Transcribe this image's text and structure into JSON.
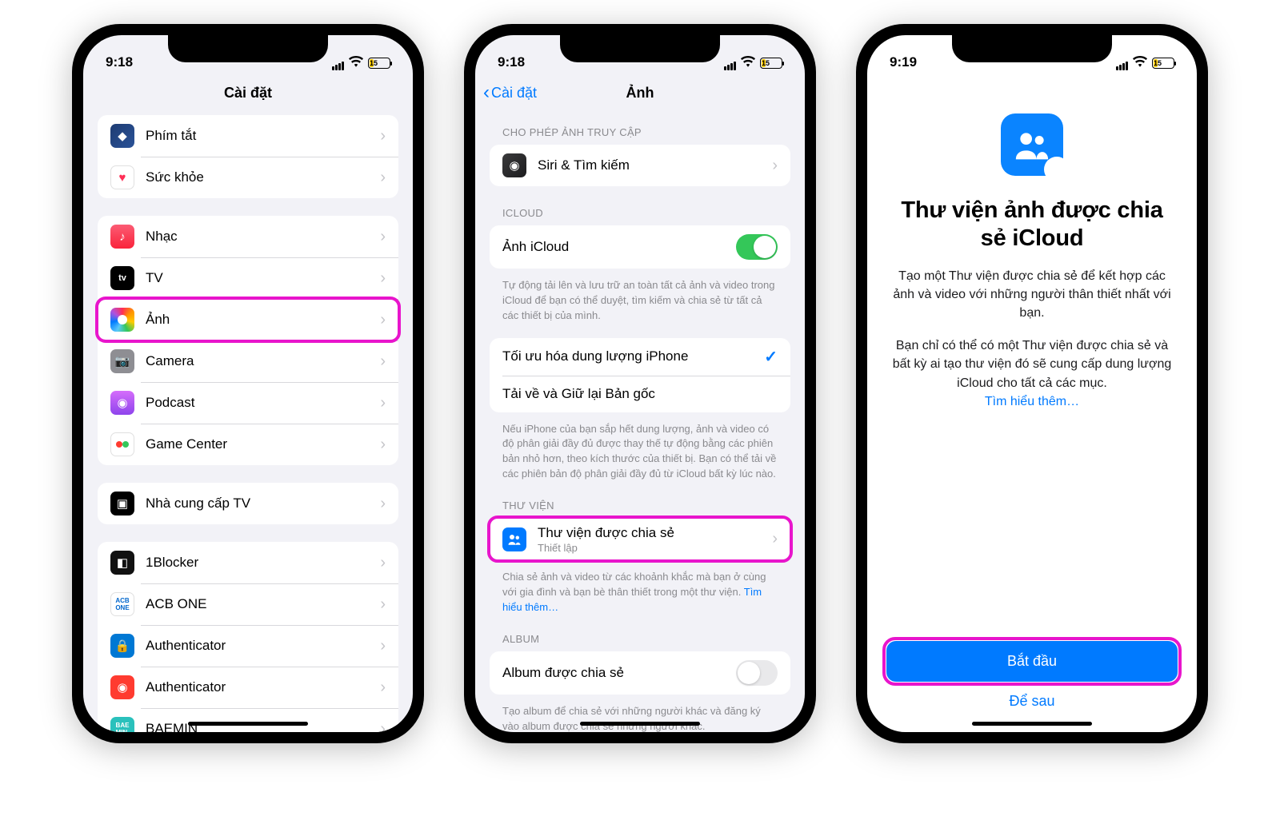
{
  "screen1": {
    "time": "9:18",
    "battery": "15",
    "title": "Cài đặt",
    "group1": [
      {
        "label": "Phím tắt"
      },
      {
        "label": "Sức khỏe"
      }
    ],
    "group2": [
      {
        "label": "Nhạc"
      },
      {
        "label": "TV"
      },
      {
        "label": "Ảnh",
        "hilite": true
      },
      {
        "label": "Camera"
      },
      {
        "label": "Podcast"
      },
      {
        "label": "Game Center"
      }
    ],
    "group3": [
      {
        "label": "Nhà cung cấp TV"
      }
    ],
    "group4": [
      {
        "label": "1Blocker"
      },
      {
        "label": "ACB ONE"
      },
      {
        "label": "Authenticator"
      },
      {
        "label": "Authenticator"
      },
      {
        "label": "BAEMIN"
      }
    ]
  },
  "screen2": {
    "time": "9:18",
    "battery": "15",
    "back_label": "Cài đặt",
    "title": "Ảnh",
    "sec_access": "CHO PHÉP ẢNH TRUY CẬP",
    "siri": "Siri & Tìm kiếm",
    "sec_icloud": "ICLOUD",
    "icloud_photos": "Ảnh iCloud",
    "icloud_desc": "Tự động tải lên và lưu trữ an toàn tất cả ảnh và video trong iCloud để bạn có thể duyệt, tìm kiếm và chia sẻ từ tất cả các thiết bị của mình.",
    "optimize": "Tối ưu hóa dung lượng iPhone",
    "download": "Tải về và Giữ lại Bản gốc",
    "optimize_desc": "Nếu iPhone của bạn sắp hết dung lượng, ảnh và video có độ phân giải đầy đủ được thay thế tự động bằng các phiên bản nhỏ hơn, theo kích thước của thiết bị. Bạn có thể tải về các phiên bản độ phân giải đầy đủ từ iCloud bất kỳ lúc nào.",
    "sec_library": "THƯ VIỆN",
    "shared_library": "Thư viện được chia sẻ",
    "shared_library_sub": "Thiết lập",
    "shared_desc": "Chia sẻ ảnh và video từ các khoảnh khắc mà bạn ở cùng với gia đình và bạn bè thân thiết trong một thư viện.",
    "learn_more": "Tìm hiểu thêm…",
    "sec_album": "ALBUM",
    "shared_album": "Album được chia sẻ",
    "album_desc": "Tạo album để chia sẻ với những người khác và đăng ký vào album được chia sẻ những người khác."
  },
  "screen3": {
    "time": "9:19",
    "battery": "15",
    "heading": "Thư viện ảnh được chia sẻ iCloud",
    "para1": "Tạo một Thư viện được chia sẻ để kết hợp các ảnh và video với những người thân thiết nhất với bạn.",
    "para2": "Bạn chỉ có thể có một Thư viện được chia sẻ và bất kỳ ai tạo thư viện đó sẽ cung cấp dung lượng iCloud cho tất cả các mục.",
    "learn_more": "Tìm hiểu thêm…",
    "start": "Bắt đầu",
    "later": "Để sau"
  }
}
